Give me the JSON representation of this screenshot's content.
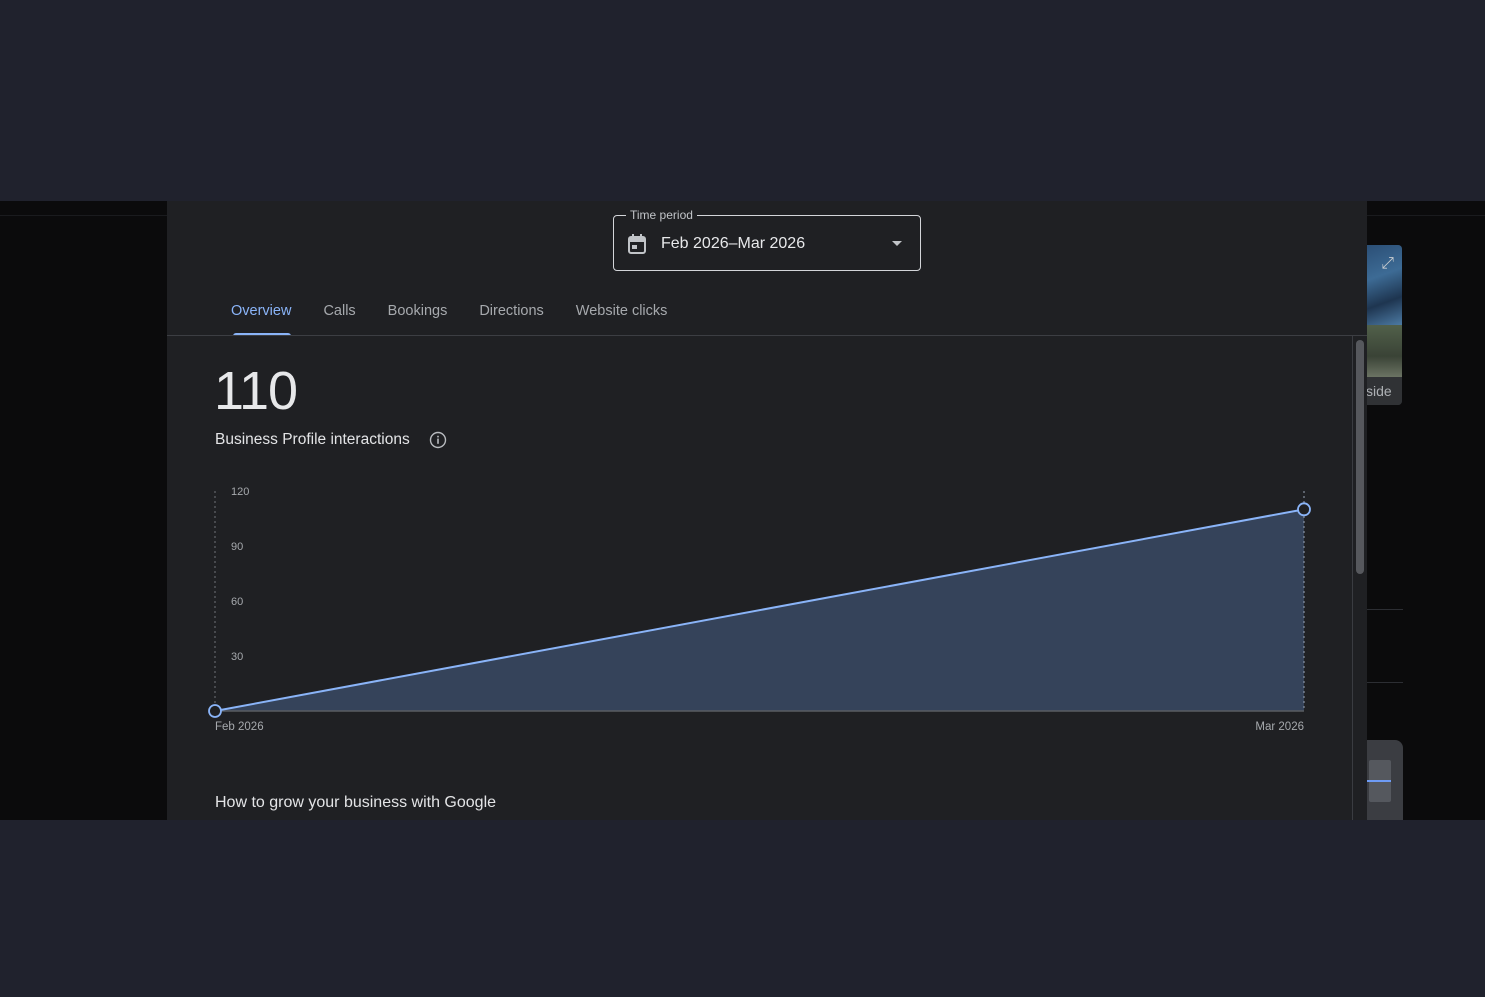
{
  "time_period": {
    "label": "Time period",
    "value": "Feb 2026–Mar 2026",
    "calendar_icon": "calendar-icon",
    "dropdown_icon": "caret-down-icon"
  },
  "tabs": [
    {
      "label": "Overview",
      "active": true
    },
    {
      "label": "Calls",
      "active": false
    },
    {
      "label": "Bookings",
      "active": false
    },
    {
      "label": "Directions",
      "active": false
    },
    {
      "label": "Website clicks",
      "active": false
    }
  ],
  "summary": {
    "total": "110",
    "label": "Business Profile interactions",
    "info_icon": "info-icon"
  },
  "chart_data": {
    "type": "area",
    "x": [
      "Feb 2026",
      "Mar 2026"
    ],
    "series": [
      {
        "values": [
          0,
          110
        ]
      }
    ],
    "yticks": [
      30,
      60,
      90,
      120
    ],
    "ylim": [
      0,
      120
    ],
    "xlabel": "",
    "ylabel": "",
    "grid": false,
    "line_color": "#8ab4f8",
    "fill_color": "#35435a"
  },
  "section": {
    "title": "How to grow your business with Google"
  },
  "background": {
    "photo_caption": "side"
  },
  "colors": {
    "accent": "#8ab4f8",
    "surface": "#1f2023",
    "backdrop": "#20222d"
  }
}
